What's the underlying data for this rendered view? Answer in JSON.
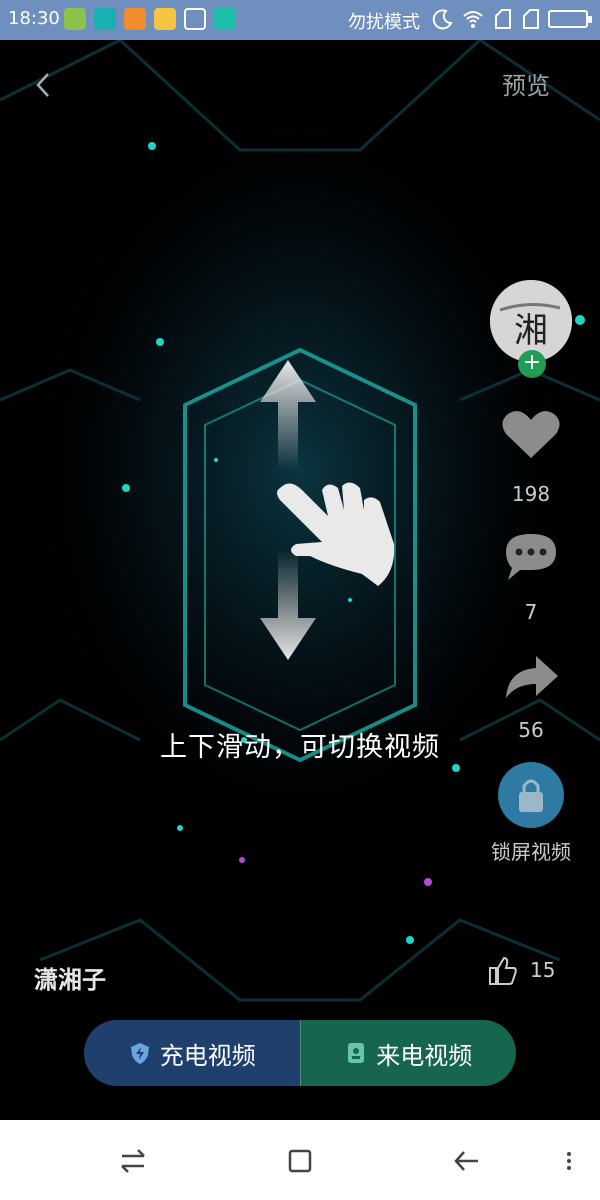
{
  "status_bar": {
    "time": "18:30",
    "dnd_label": "勿扰模式",
    "icons": [
      "bag-icon",
      "app-icon",
      "warning-icon",
      "folder-icon",
      "brush-icon",
      "usb-icon",
      "moon-icon",
      "wifi-icon",
      "signal-icon",
      "signal-icon",
      "battery-icon"
    ]
  },
  "header": {
    "back_icon": "back-chevron-icon",
    "preview_label": "预览"
  },
  "overlay": {
    "hint": "上下滑动，可切换视频",
    "gesture_icon": "swipe-up-down-hand-icon"
  },
  "sidebar": {
    "avatar_icon": "avatar-image",
    "follow_icon": "plus-icon",
    "likes": "198",
    "comments": "7",
    "shares": "56",
    "lock_label": "锁屏视频"
  },
  "footer": {
    "author": "潇湘子",
    "thumb_count": "15",
    "charge_video_label": "充电视频",
    "call_video_label": "来电视频"
  },
  "nav_bar": {
    "icons": [
      "swap-icon",
      "square-icon",
      "back-arrow-icon",
      "menu-icon"
    ]
  },
  "colors": {
    "status_bar": "#6f8fbe",
    "charge_bg": "#1f3f6d",
    "call_bg": "#16654e",
    "lock_bg": "#2f7aa3",
    "accent_teal": "#1fd6c4"
  }
}
